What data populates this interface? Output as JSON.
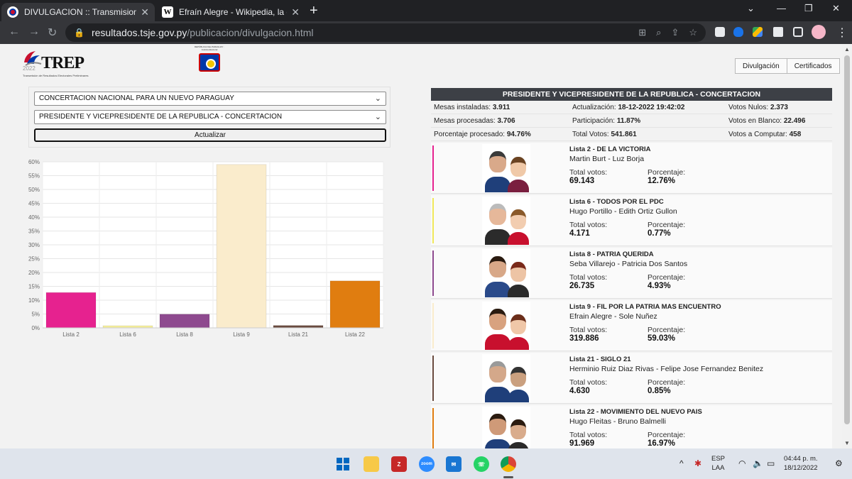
{
  "browser": {
    "tabs": [
      {
        "title": "DIVULGACION :: Transmision de R",
        "close": "✕"
      },
      {
        "title": "Efraín Alegre - Wikipedia, la encic",
        "close": "✕"
      }
    ],
    "wiki_favicon": "W",
    "new_tab": "+",
    "window_controls": {
      "chevron": "⌄",
      "minimize": "—",
      "restore": "❐",
      "close": "✕"
    },
    "url_host": "resultados.tsje.gov.py",
    "url_path": "/publicacion/divulgacion.html",
    "icons": [
      "back-icon",
      "forward-icon",
      "reload-icon",
      "lock-icon",
      "translate-icon",
      "zoom-icon",
      "share-icon",
      "star-icon",
      "extensions-icon",
      "menu-icon"
    ]
  },
  "header": {
    "trep_logo": "TREP",
    "trep_year": "2022",
    "trep_sub": "Transmisión de Resultados Electorales Preliminares",
    "tsje_logo": "REPÚBLICA DEL PARAGUAY · Justicia Electoral",
    "buttons": {
      "divulgacion": "Divulgación",
      "certificados": "Certificados"
    }
  },
  "form": {
    "party_select": "CONCERTACION NACIONAL PARA UN NUEVO PARAGUAY",
    "office_select": "PRESIDENTE Y VICEPRESIDENTE DE LA REPUBLICA - CONCERTACION",
    "update_button": "Actualizar"
  },
  "chart_data": {
    "type": "bar",
    "categories": [
      "Lista 2",
      "Lista 6",
      "Lista 8",
      "Lista 9",
      "Lista 21",
      "Lista 22"
    ],
    "values": [
      12.76,
      0.77,
      4.93,
      59.03,
      0.85,
      16.97
    ],
    "colors": [
      "#e6228f",
      "#f5ee9a",
      "#8e4a8f",
      "#faeccc",
      "#6a4b3f",
      "#e07d10"
    ],
    "ylim": [
      0,
      60
    ],
    "yticks": [
      "0%",
      "5%",
      "10%",
      "15%",
      "20%",
      "25%",
      "30%",
      "35%",
      "40%",
      "45%",
      "50%",
      "55%",
      "60%"
    ],
    "grid": true
  },
  "results": {
    "title": "PRESIDENTE Y VICEPRESIDENTE DE LA REPUBLICA - CONCERTACION",
    "stats": {
      "mesas_instaladas_label": "Mesas instaladas:",
      "mesas_instaladas": "3.911",
      "actualizacion_label": "Actualización:",
      "actualizacion": "18-12-2022 19:42:02",
      "votos_nulos_label": "Votos Nulos:",
      "votos_nulos": "2.373",
      "mesas_procesadas_label": "Mesas procesadas:",
      "mesas_procesadas": "3.706",
      "participacion_label": "Participación:",
      "participacion": "11.87%",
      "votos_blanco_label": "Votos en Blanco:",
      "votos_blanco": "22.496",
      "porcentaje_procesado_label": "Porcentaje procesado:",
      "porcentaje_procesado": "94.76%",
      "total_votos_label": "Total Votos:",
      "total_votos": "541.861",
      "votos_computar_label": "Votos a Computar:",
      "votos_computar": "458"
    },
    "total_votos_label": "Total votos:",
    "porcentaje_label": "Porcentaje:",
    "candidates": [
      {
        "lista": "Lista 2 - DE LA VICTORIA",
        "names": "Martin Burt - Luz Borja",
        "votes": "69.143",
        "pct": "12.76%",
        "color": "#e6228f"
      },
      {
        "lista": "Lista 6 - TODOS POR EL PDC",
        "names": "Hugo Portillo - Edith Ortiz Gullon",
        "votes": "4.171",
        "pct": "0.77%",
        "color": "#f1e85a"
      },
      {
        "lista": "Lista 8 - PATRIA QUERIDA",
        "names": "Seba Villarejo - Patricia Dos Santos",
        "votes": "26.735",
        "pct": "4.93%",
        "color": "#8e4a8f"
      },
      {
        "lista": "Lista 9 - FIL POR LA PATRIA MAS ENCUENTRO",
        "names": "Efrain Alegre - Sole Nuñez",
        "votes": "319.886",
        "pct": "59.03%",
        "color": "#faeccc"
      },
      {
        "lista": "Lista 21 - SIGLO 21",
        "names": "Herminio Ruiz Diaz Rivas - Felipe Jose Fernandez Benitez",
        "votes": "4.630",
        "pct": "0.85%",
        "color": "#6a4b3f"
      },
      {
        "lista": "Lista 22 - MOVIMIENTO DEL NUEVO PAIS",
        "names": "Hugo Fleitas - Bruno Balmelli",
        "votes": "91.969",
        "pct": "16.97%",
        "color": "#e07d10"
      }
    ]
  },
  "taskbar": {
    "zoom_label": "zoom",
    "lang": "ESP",
    "layout": "LAA",
    "time": "04:44 p. m.",
    "date": "18/12/2022"
  }
}
